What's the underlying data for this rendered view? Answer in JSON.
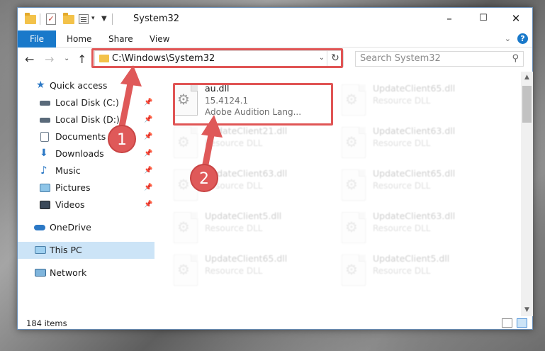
{
  "window": {
    "title": "System32",
    "controls": {
      "minimize": "–",
      "maximize": "☐",
      "close": "✕"
    }
  },
  "ribbon": {
    "file_tab": "File",
    "tabs": [
      "Home",
      "Share",
      "View"
    ],
    "help": "?"
  },
  "navbar": {
    "address": "C:\\Windows\\System32",
    "search_placeholder": "Search System32"
  },
  "sidebar": {
    "quick_access": "Quick access",
    "pinned": [
      {
        "label": "Local Disk (C:)",
        "icon": "drive-icon"
      },
      {
        "label": "Local Disk (D:)",
        "icon": "drive-icon"
      },
      {
        "label": "Documents",
        "icon": "documents-icon"
      },
      {
        "label": "Downloads",
        "icon": "downloads-icon"
      },
      {
        "label": "Music",
        "icon": "music-icon"
      },
      {
        "label": "Pictures",
        "icon": "pictures-icon"
      },
      {
        "label": "Videos",
        "icon": "videos-icon"
      }
    ],
    "onedrive": "OneDrive",
    "this_pc": "This PC",
    "network": "Network"
  },
  "files": {
    "highlighted": {
      "name": "au.dll",
      "version": "15.4124.1",
      "description": "Adobe Audition Lang..."
    },
    "background": [
      {
        "name": "UpdateClient65.dll",
        "type": "Resource DLL"
      },
      {
        "name": "UpdateClient21.dll",
        "type": "Resource DLL"
      },
      {
        "name": "UpdateClient63.dll",
        "type": "Resource DLL"
      },
      {
        "name": "UpdateClient63.dll",
        "type": "Resource DLL"
      },
      {
        "name": "UpdateClient65.dll",
        "type": "Resource DLL"
      },
      {
        "name": "UpdateClient5.dll",
        "type": "Resource DLL"
      },
      {
        "name": "UpdateClient63.dll",
        "type": "Resource DLL"
      },
      {
        "name": "UpdateClient65.dll",
        "type": "Resource DLL"
      },
      {
        "name": "UpdateClient5.dll",
        "type": "Resource DLL"
      }
    ]
  },
  "status": {
    "item_count": "184 items"
  },
  "callouts": [
    "1",
    "2"
  ],
  "colors": {
    "accent": "#1979ca",
    "highlight": "#e05555",
    "selected": "#cce4f7"
  }
}
